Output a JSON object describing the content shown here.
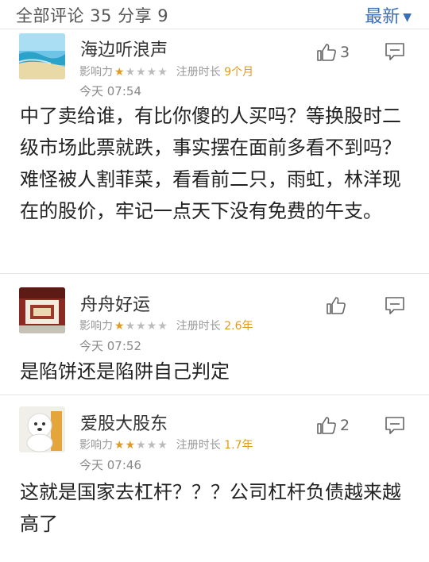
{
  "header": {
    "title": "全部评论 35 分享 9",
    "sort_label": "最新",
    "sort_caret": "▼"
  },
  "comments": [
    {
      "username": "海边听浪声",
      "influence_label": "影响力",
      "stars_on": "★",
      "stars_off": "★★★★",
      "reg_label": "注册时长",
      "reg_value": "9个月",
      "time": "今天 07:54",
      "text": "中了卖给谁，有比你傻的人买吗？等换股时二级市场此票就跌，事实摆在面前多看不到吗？难怪被人割菲菜，看看前二只，雨虹，林洋现在的股价，牢记一点天下没有免费的午支。",
      "likes": "3"
    },
    {
      "username": "舟舟好运",
      "influence_label": "影响力",
      "stars_on": "★",
      "stars_off": "★★★★",
      "reg_label": "注册时长",
      "reg_value": "2.6年",
      "time": "今天 07:52",
      "text": "是陷饼还是陷阱自己判定",
      "likes": ""
    },
    {
      "username": "爱股大股东",
      "influence_label": "影响力",
      "stars_on": "★★",
      "stars_off": "★★★",
      "reg_label": "注册时长",
      "reg_value": "1.7年",
      "time": "今天 07:46",
      "text": "这就是国家去杠杆？？？公司杠杆负债越来越高了",
      "likes": "2"
    }
  ],
  "colors": {
    "accent": "#3b6fb5",
    "star_on": "#e39a1c",
    "star_off": "#bbbbbb"
  }
}
